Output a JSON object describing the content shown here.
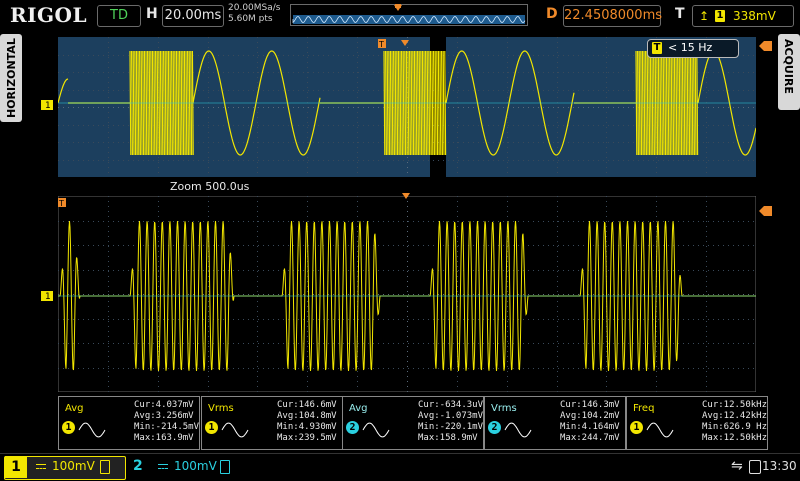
{
  "brand": "RIGOL",
  "top": {
    "run_state": "TD",
    "h_label": "H",
    "timebase": "20.00ms",
    "sample_rate": "20.00MSa/s",
    "memory_depth": "5.60M pts",
    "d_label": "D",
    "delay": "22.4508000ms",
    "t_label": "T",
    "trigger_channel": "1",
    "trigger_level": "338mV"
  },
  "side": {
    "left_tab": "HORIZONTAL",
    "right_tab": "ACQUIRE"
  },
  "main": {
    "trigger_filter": "< 15 Hz",
    "zoom_label": "Zoom  500.0us",
    "ch1_marker": "1",
    "trig_marker": "T"
  },
  "measurements": [
    {
      "name": "Avg",
      "channel": "1",
      "color": "#f2e600",
      "lines": [
        "Cur:4.037mV",
        "Avg:3.256mV",
        "Min:-214.5mV",
        "Max:163.9mV"
      ]
    },
    {
      "name": "Vrms",
      "channel": "1",
      "color": "#f2e600",
      "lines": [
        "Cur:146.6mV",
        "Avg:104.8mV",
        "Min:4.930mV",
        "Max:239.5mV"
      ]
    },
    {
      "name": "Avg",
      "channel": "2",
      "color": "#2ad0e0",
      "lines": [
        "Cur:-634.3uV",
        "Avg:-1.073mV",
        "Min:-220.1mV",
        "Max:158.9mV"
      ]
    },
    {
      "name": "Vrms",
      "channel": "2",
      "color": "#2ad0e0",
      "lines": [
        "Cur:146.3mV",
        "Avg:104.2mV",
        "Min:4.164mV",
        "Max:244.7mV"
      ]
    },
    {
      "name": "Freq",
      "channel": "1",
      "color": "#f2e600",
      "lines": [
        "Cur:12.50kHz",
        "Avg:12.42kHz",
        "Min:626.9 Hz",
        "Max:12.50kHz"
      ]
    }
  ],
  "bottom": {
    "ch1_label": "1",
    "ch1_scale": "100mV",
    "ch2_label": "2",
    "ch2_scale": "100mV",
    "clock": "13:30"
  },
  "colors": {
    "ch1": "#f2e600",
    "ch2": "#2ad0e0",
    "trigger": "#f08a2a",
    "overview_bg": "#1c3f5e"
  }
}
